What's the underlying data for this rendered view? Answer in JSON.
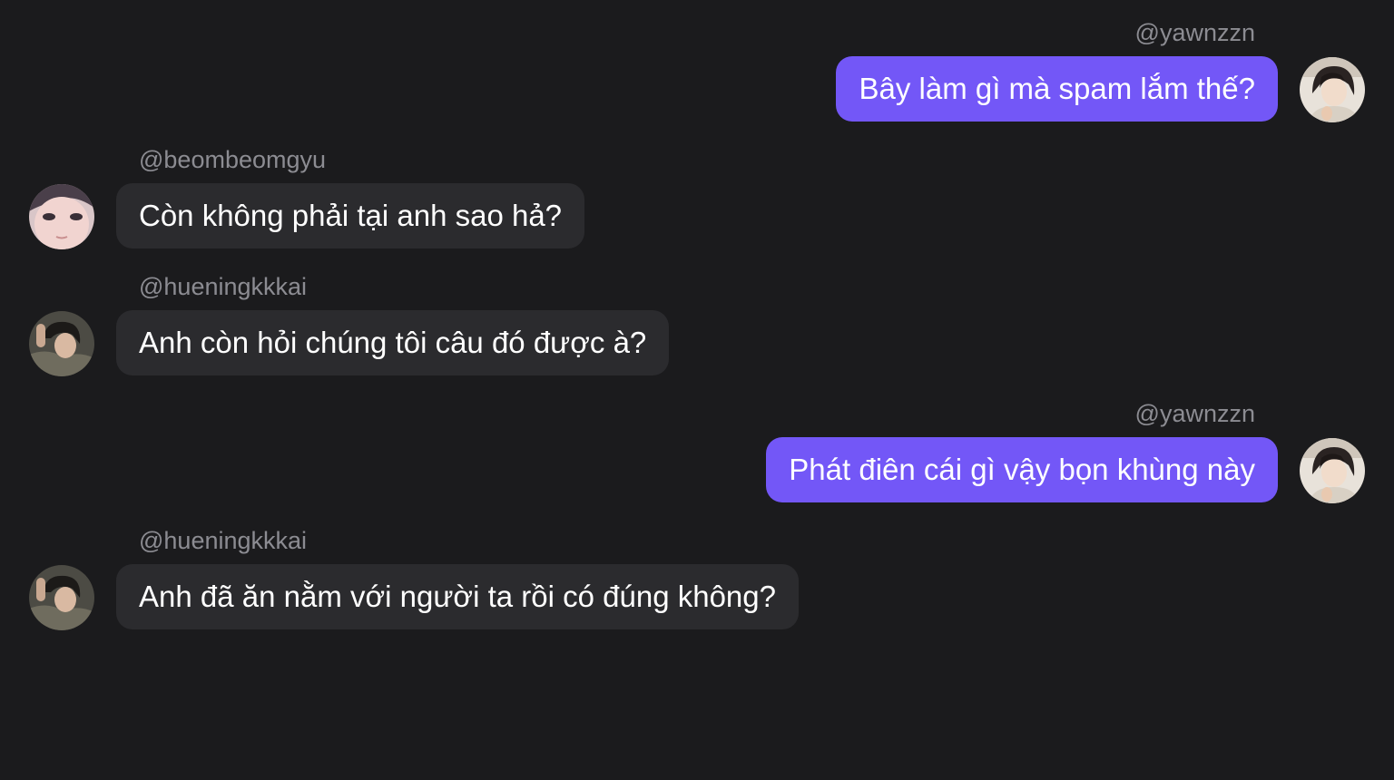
{
  "messages": [
    {
      "username": "@yawnzzn",
      "text": "Bây làm gì mà spam lắm thế?",
      "direction": "outgoing",
      "avatar": "avatar-yawnzzn"
    },
    {
      "username": "@beombeomgyu",
      "text": " Còn không phải tại anh sao hả?",
      "direction": "incoming",
      "avatar": "avatar-beombeomgyu"
    },
    {
      "username": "@hueningkkkai",
      "text": "Anh còn hỏi chúng tôi câu đó được à?",
      "direction": "incoming",
      "avatar": "avatar-hueningkkkai"
    },
    {
      "username": "@yawnzzn",
      "text": "Phát điên cái gì vậy bọn khùng này",
      "direction": "outgoing",
      "avatar": "avatar-yawnzzn"
    },
    {
      "username": "@hueningkkkai",
      "text": "Anh đã ăn nằm với người ta rồi có đúng không?",
      "direction": "incoming",
      "avatar": "avatar-hueningkkkai"
    }
  ],
  "colors": {
    "background": "#1b1b1d",
    "outgoing_bubble": "#7357f7",
    "incoming_bubble": "#2b2b2e",
    "username": "#8c8c92",
    "text": "#ffffff"
  }
}
